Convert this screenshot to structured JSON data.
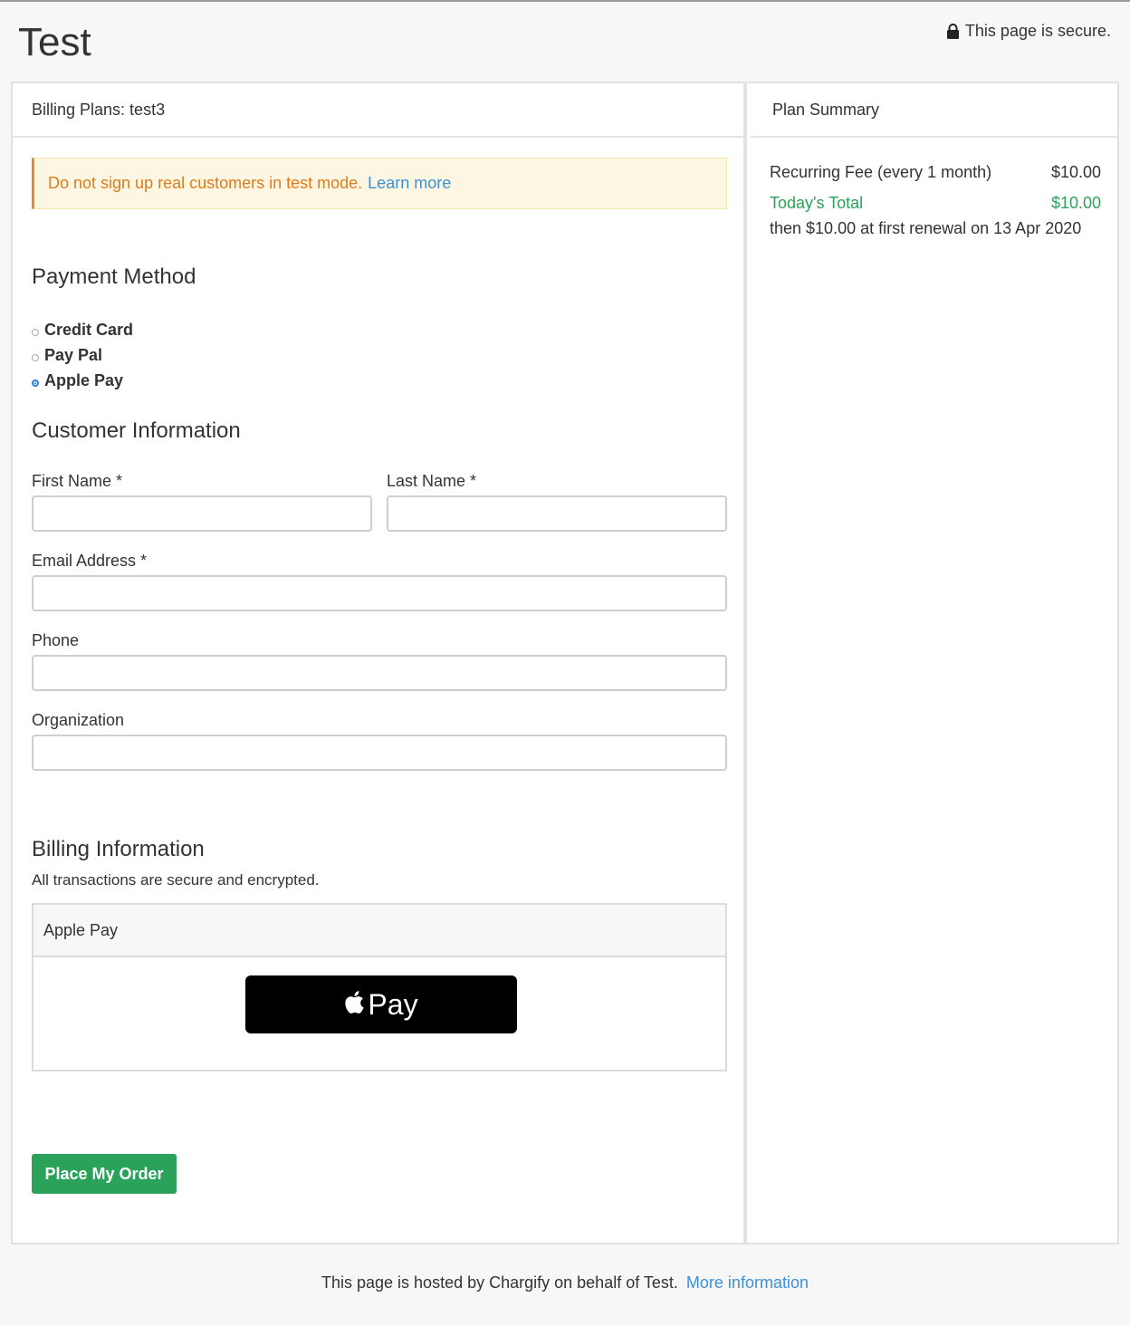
{
  "header": {
    "title": "Test",
    "secure_text": "This page is secure."
  },
  "left_card": {
    "title": "Billing Plans: test3",
    "alert": {
      "text": "Do not sign up real customers in test mode.",
      "link": "Learn more"
    },
    "payment_method": {
      "heading": "Payment Method",
      "options": [
        {
          "label": "Credit Card",
          "checked": false
        },
        {
          "label": "Pay Pal",
          "checked": false
        },
        {
          "label": "Apple Pay",
          "checked": true
        }
      ]
    },
    "customer_info": {
      "heading": "Customer Information",
      "first_name_label": "First Name *",
      "last_name_label": "Last Name *",
      "email_label": "Email Address *",
      "phone_label": "Phone",
      "organization_label": "Organization",
      "first_name_value": "",
      "last_name_value": "",
      "email_value": "",
      "phone_value": "",
      "organization_value": ""
    },
    "billing_info": {
      "heading": "Billing Information",
      "description": "All transactions are secure and encrypted.",
      "box_title": "Apple Pay",
      "apple_pay_button": "Pay"
    },
    "submit_label": "Place My Order"
  },
  "right_card": {
    "title": "Plan Summary",
    "recurring_label": "Recurring Fee (every 1 month)",
    "recurring_amount": "$10.00",
    "total_label": "Today's Total",
    "total_amount": "$10.00",
    "renewal_text": "then $10.00 at first renewal on 13 Apr 2020"
  },
  "footer": {
    "text": "This page is hosted by Chargify on behalf of Test.",
    "link": "More information"
  },
  "colors": {
    "accent_green": "#2ba25a",
    "link_blue": "#3d8fd6",
    "alert_orange": "#e07b1a"
  }
}
